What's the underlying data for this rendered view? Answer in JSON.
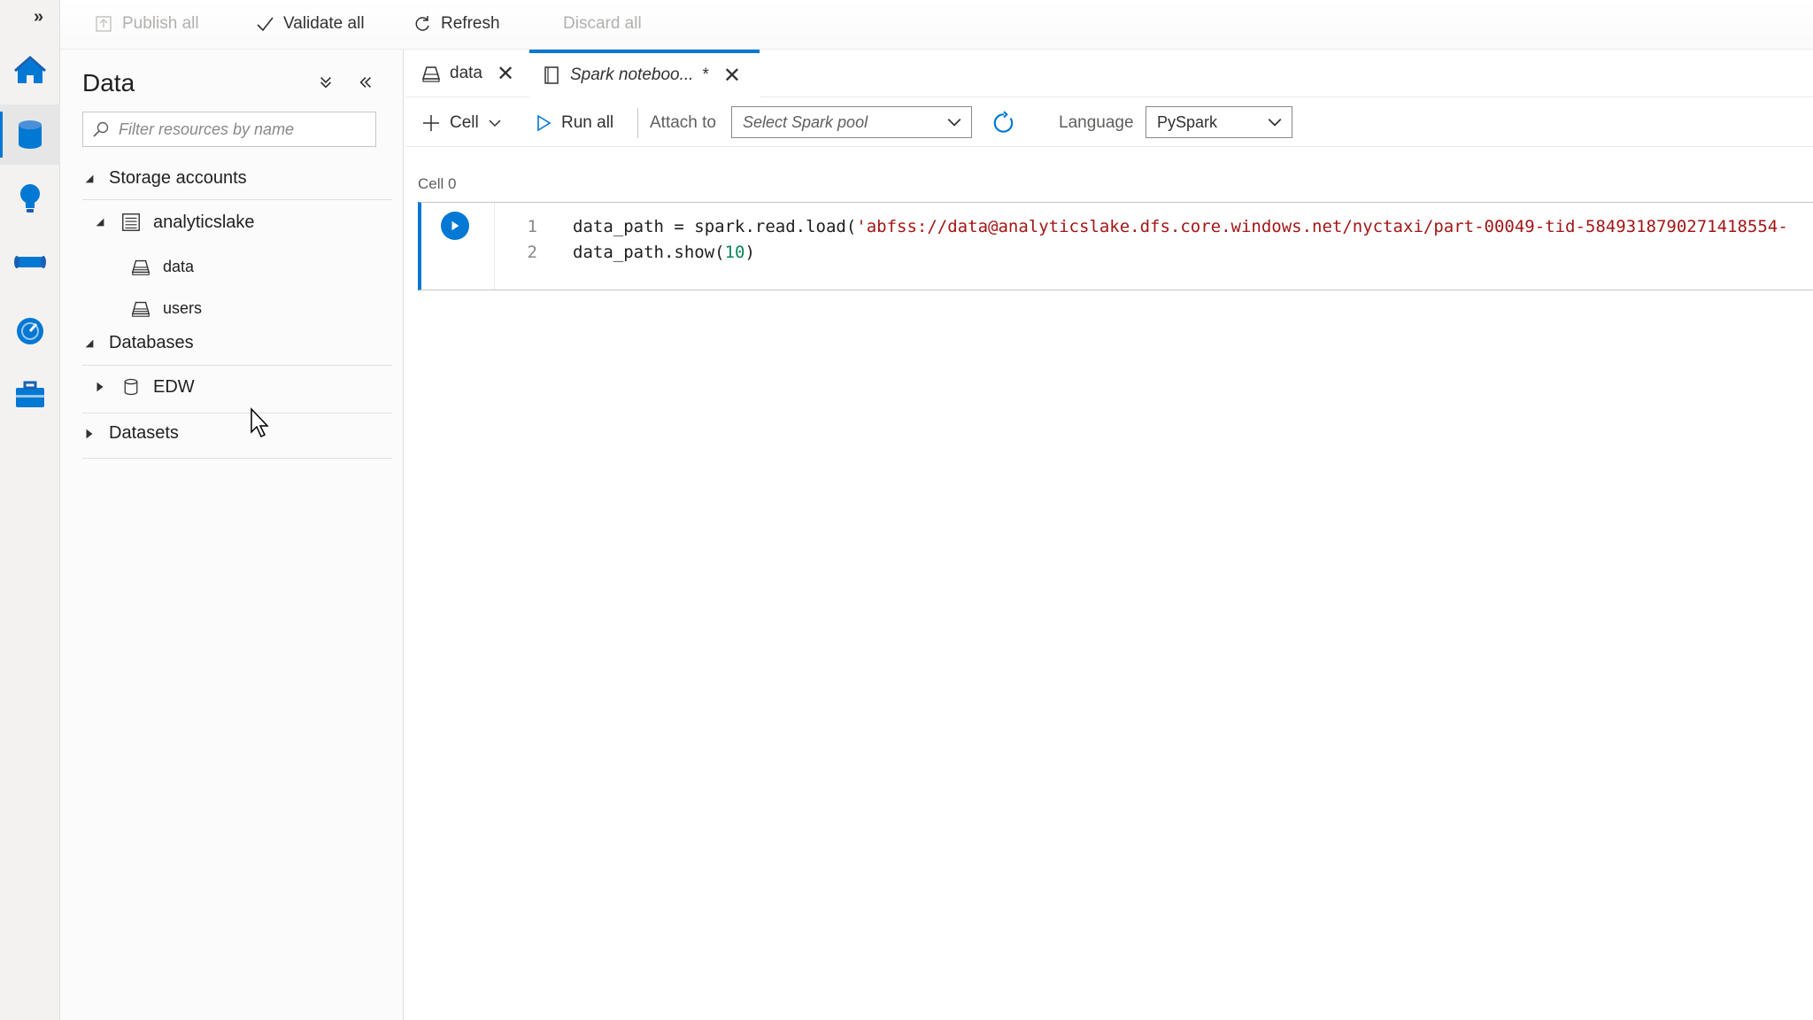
{
  "rail": {
    "expand_label": "»",
    "items": [
      {
        "name": "home",
        "icon": "home-icon"
      },
      {
        "name": "data",
        "icon": "database-icon",
        "active": true
      },
      {
        "name": "develop",
        "icon": "lightbulb-icon"
      },
      {
        "name": "orchestrate",
        "icon": "pipeline-icon"
      },
      {
        "name": "monitor",
        "icon": "gauge-icon"
      },
      {
        "name": "manage",
        "icon": "toolbox-icon"
      }
    ]
  },
  "topbar": {
    "publish_all": "Publish all",
    "validate_all": "Validate all",
    "refresh": "Refresh",
    "discard_all": "Discard all"
  },
  "panel": {
    "title": "Data",
    "filter_placeholder": "Filter resources by name",
    "storage_accounts": "Storage accounts",
    "storage_account_name": "analyticslake",
    "containers": [
      "data",
      "users"
    ],
    "databases": "Databases",
    "database_items": [
      "EDW"
    ],
    "datasets": "Datasets"
  },
  "tabs": [
    {
      "label": "data",
      "icon": "container-icon"
    },
    {
      "label": "Spark noteboo...",
      "dirty": "*",
      "icon": "notebook-icon",
      "active": true
    }
  ],
  "toolbar": {
    "cell": "Cell",
    "run_all": "Run all",
    "attach_to": "Attach to",
    "spark_pool_placeholder": "Select Spark pool",
    "language_label": "Language",
    "language_value": "PySpark"
  },
  "notebook": {
    "cell_label": "Cell 0",
    "lines": [
      {
        "num": "1",
        "prefix": "data_path = spark.read.load(",
        "string": "'abfss://data@analyticslake.dfs.core.windows.net/nyctaxi/part-00049-tid-5849318790271418554-"
      },
      {
        "num": "2",
        "prefix": "data_path.show(",
        "number": "10",
        "suffix": ")"
      }
    ]
  },
  "colors": {
    "accent": "#0078d4",
    "string": "#a31515",
    "number": "#098658"
  }
}
